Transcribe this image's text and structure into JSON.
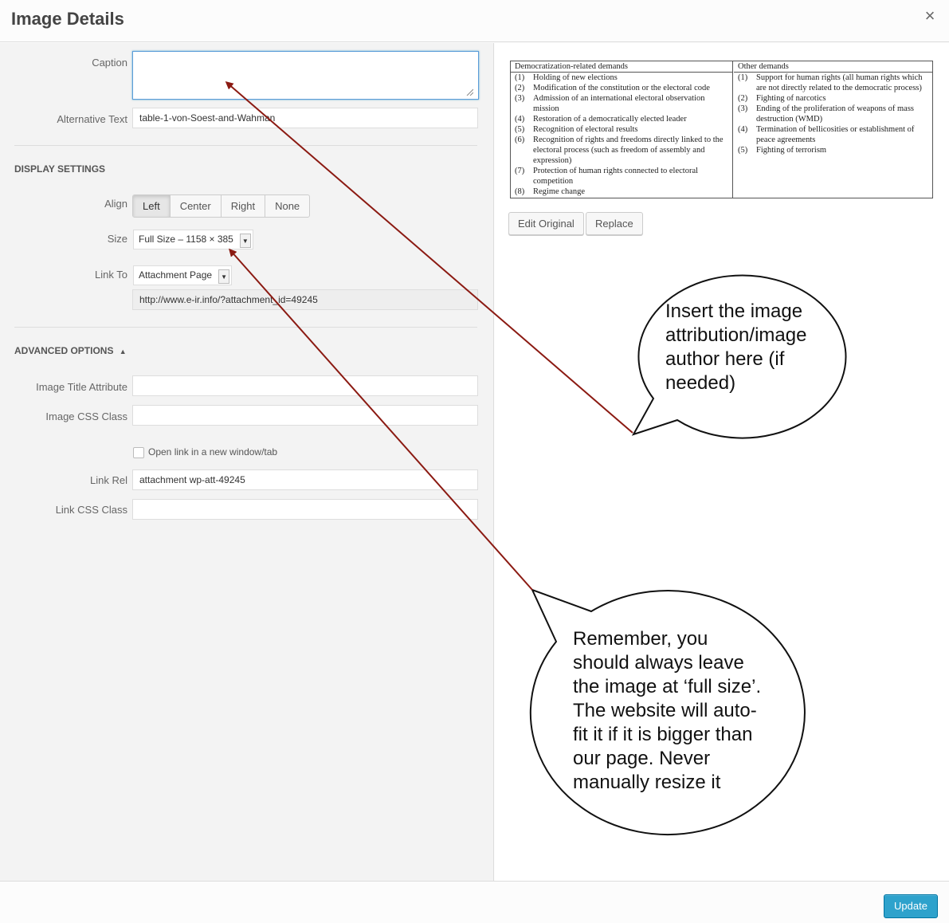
{
  "header": {
    "title": "Image Details",
    "close": "×"
  },
  "form": {
    "caption_label": "Caption",
    "caption_value": "",
    "alt_label": "Alternative Text",
    "alt_value": "table-1-von-Soest-and-Wahman",
    "display_settings": "DISPLAY SETTINGS",
    "align_label": "Align",
    "align_options": [
      "Left",
      "Center",
      "Right",
      "None"
    ],
    "align_selected": "Left",
    "size_label": "Size",
    "size_value": "Full Size – 1158 × 385",
    "link_to_label": "Link To",
    "link_to_value": "Attachment Page",
    "link_url": "http://www.e-ir.info/?attachment_id=49245",
    "advanced_options": "ADVANCED OPTIONS",
    "advanced_toggle_icon": "▲",
    "title_attr_label": "Image Title Attribute",
    "title_attr_value": "",
    "css_class_label": "Image CSS Class",
    "css_class_value": "",
    "new_window_label": "Open link in a new window/tab",
    "new_window_checked": false,
    "link_rel_label": "Link Rel",
    "link_rel_value": "attachment wp-att-49245",
    "link_css_label": "Link CSS Class",
    "link_css_value": ""
  },
  "preview": {
    "left_header": "Democratization-related demands",
    "right_header": "Other demands",
    "left_items": [
      {
        "num": "(1)",
        "text": "Holding of new elections"
      },
      {
        "num": "(2)",
        "text": "Modification of the constitution or the electoral code"
      },
      {
        "num": "(3)",
        "text": "Admission of an international electoral observation mission"
      },
      {
        "num": "(4)",
        "text": "Restoration of a democratically elected leader"
      },
      {
        "num": "(5)",
        "text": "Recognition of electoral results"
      },
      {
        "num": "(6)",
        "text": "Recognition of rights and freedoms directly linked to the electoral process (such as freedom of assembly and expression)"
      },
      {
        "num": "(7)",
        "text": "Protection of human rights connected to electoral competition"
      },
      {
        "num": "(8)",
        "text": "Regime change"
      }
    ],
    "right_items": [
      {
        "num": "(1)",
        "text": "Support for human rights (all human rights which are not directly related to the democratic process)"
      },
      {
        "num": "(2)",
        "text": "Fighting of narcotics"
      },
      {
        "num": "(3)",
        "text": "Ending of the proliferation of weapons of mass destruction (WMD)"
      },
      {
        "num": "(4)",
        "text": "Termination of bellicosities or establishment of peace agreements"
      },
      {
        "num": "(5)",
        "text": "Fighting of terrorism"
      }
    ],
    "edit_original": "Edit Original",
    "replace": "Replace"
  },
  "footer": {
    "update": "Update"
  },
  "annotations": {
    "bubble1": [
      "Insert the image",
      "attribution/image",
      "author here (if",
      "needed)"
    ],
    "bubble2": [
      "Remember, you",
      "should always leave",
      "the image at ‘full size’.",
      "The website will auto-",
      "fit it if it is bigger than",
      "our page. Never",
      "manually resize it"
    ]
  },
  "colors": {
    "accent": "#2ea2cc",
    "arrow": "#8b1a12"
  }
}
